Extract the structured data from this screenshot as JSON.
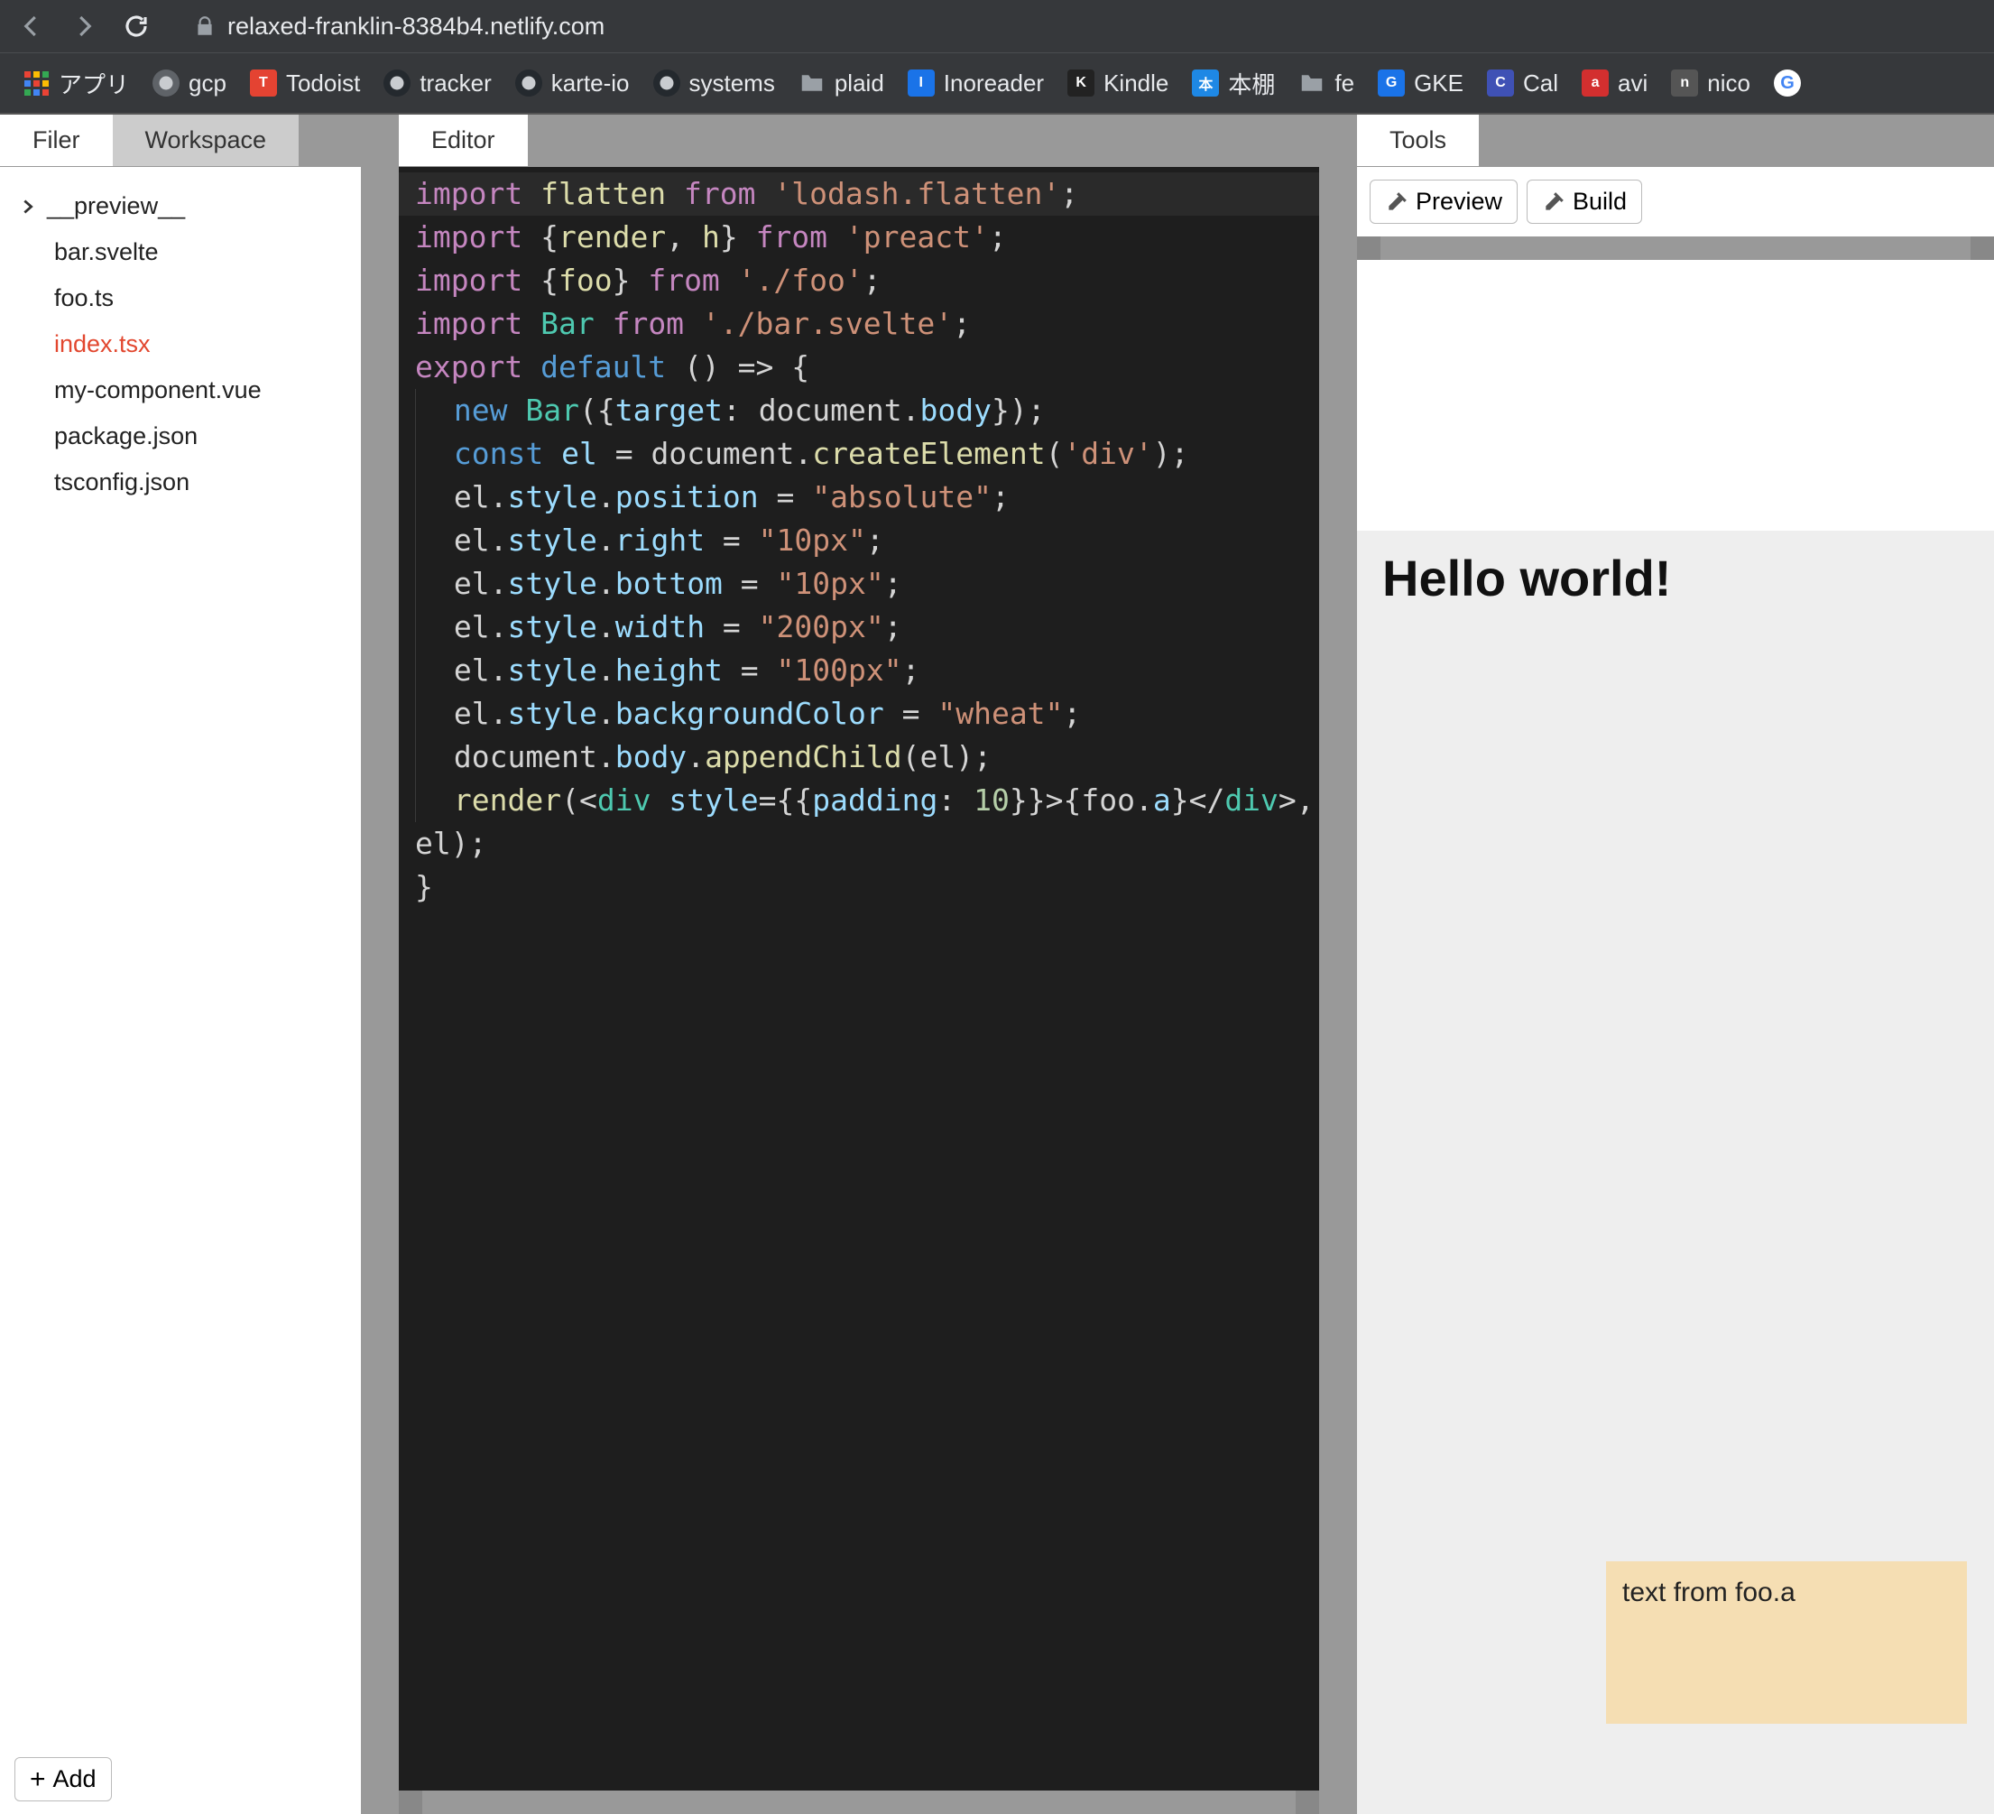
{
  "browser": {
    "url": "relaxed-franklin-8384b4.netlify.com",
    "bookmarks": [
      {
        "label": "アプリ",
        "kind": "apps"
      },
      {
        "label": "gcp",
        "kind": "g"
      },
      {
        "label": "Todoist",
        "kind": "todoist"
      },
      {
        "label": "tracker",
        "kind": "gh"
      },
      {
        "label": "karte-io",
        "kind": "gh"
      },
      {
        "label": "systems",
        "kind": "gh"
      },
      {
        "label": "plaid",
        "kind": "folder"
      },
      {
        "label": "Inoreader",
        "kind": "inoreader"
      },
      {
        "label": "Kindle",
        "kind": "kindle"
      },
      {
        "label": "本棚",
        "kind": "book"
      },
      {
        "label": "fe",
        "kind": "folder"
      },
      {
        "label": "GKE",
        "kind": "gke"
      },
      {
        "label": "Cal",
        "kind": "cal"
      },
      {
        "label": "avi",
        "kind": "avi"
      },
      {
        "label": "nico",
        "kind": "nico"
      }
    ]
  },
  "sidebar": {
    "tabs": {
      "filer": "Filer",
      "workspace": "Workspace"
    },
    "files": [
      {
        "name": "__preview__",
        "folder": true
      },
      {
        "name": "bar.svelte"
      },
      {
        "name": "foo.ts"
      },
      {
        "name": "index.tsx",
        "active": true
      },
      {
        "name": "my-component.vue"
      },
      {
        "name": "package.json"
      },
      {
        "name": "tsconfig.json"
      }
    ],
    "add_label": "Add"
  },
  "editor": {
    "tab": "Editor",
    "lines": [
      [
        [
          "key",
          "import"
        ],
        [
          "sp",
          " "
        ],
        [
          "fn",
          "flatten"
        ],
        [
          "sp",
          " "
        ],
        [
          "from",
          "from"
        ],
        [
          "sp",
          " "
        ],
        [
          "str",
          "'lodash.flatten'"
        ],
        [
          "punc",
          ";"
        ]
      ],
      [
        [
          "key",
          "import"
        ],
        [
          "sp",
          " "
        ],
        [
          "punc",
          "{"
        ],
        [
          "fn",
          "render"
        ],
        [
          "punc",
          ", "
        ],
        [
          "fn",
          "h"
        ],
        [
          "punc",
          "}"
        ],
        [
          "sp",
          " "
        ],
        [
          "from",
          "from"
        ],
        [
          "sp",
          " "
        ],
        [
          "str",
          "'preact'"
        ],
        [
          "punc",
          ";"
        ]
      ],
      [
        [
          "key",
          "import"
        ],
        [
          "sp",
          " "
        ],
        [
          "punc",
          "{"
        ],
        [
          "fn",
          "foo"
        ],
        [
          "punc",
          "}"
        ],
        [
          "sp",
          " "
        ],
        [
          "from",
          "from"
        ],
        [
          "sp",
          " "
        ],
        [
          "str",
          "'./foo'"
        ],
        [
          "punc",
          ";"
        ]
      ],
      [
        [
          "key",
          "import"
        ],
        [
          "sp",
          " "
        ],
        [
          "cls",
          "Bar"
        ],
        [
          "sp",
          " "
        ],
        [
          "from",
          "from"
        ],
        [
          "sp",
          " "
        ],
        [
          "str",
          "'./bar.svelte'"
        ],
        [
          "punc",
          ";"
        ]
      ],
      [
        [
          "key",
          "export"
        ],
        [
          "sp",
          " "
        ],
        [
          "def",
          "default"
        ],
        [
          "sp",
          " "
        ],
        [
          "punc",
          "() => {"
        ]
      ],
      [
        [
          "indent"
        ],
        [
          "const",
          "new"
        ],
        [
          "sp",
          " "
        ],
        [
          "cls",
          "Bar"
        ],
        [
          "punc",
          "({"
        ],
        [
          "prop",
          "target"
        ],
        [
          "punc",
          ": "
        ],
        [
          "id",
          "document"
        ],
        [
          "punc",
          "."
        ],
        [
          "prop",
          "body"
        ],
        [
          "punc",
          "});"
        ]
      ],
      [
        [
          "indent"
        ],
        [
          "const",
          "const"
        ],
        [
          "sp",
          " "
        ],
        [
          "prop",
          "el"
        ],
        [
          "sp",
          " = "
        ],
        [
          "id",
          "document"
        ],
        [
          "punc",
          "."
        ],
        [
          "fn",
          "createElement"
        ],
        [
          "punc",
          "("
        ],
        [
          "str",
          "'div'"
        ],
        [
          "punc",
          ");"
        ]
      ],
      [
        [
          "indent"
        ],
        [
          "id",
          "el"
        ],
        [
          "punc",
          "."
        ],
        [
          "prop",
          "style"
        ],
        [
          "punc",
          "."
        ],
        [
          "prop",
          "position"
        ],
        [
          "sp",
          " = "
        ],
        [
          "str",
          "\"absolute\""
        ],
        [
          "punc",
          ";"
        ]
      ],
      [
        [
          "indent"
        ],
        [
          "id",
          "el"
        ],
        [
          "punc",
          "."
        ],
        [
          "prop",
          "style"
        ],
        [
          "punc",
          "."
        ],
        [
          "prop",
          "right"
        ],
        [
          "sp",
          " = "
        ],
        [
          "str",
          "\"10px\""
        ],
        [
          "punc",
          ";"
        ]
      ],
      [
        [
          "indent"
        ],
        [
          "id",
          "el"
        ],
        [
          "punc",
          "."
        ],
        [
          "prop",
          "style"
        ],
        [
          "punc",
          "."
        ],
        [
          "prop",
          "bottom"
        ],
        [
          "sp",
          " = "
        ],
        [
          "str",
          "\"10px\""
        ],
        [
          "punc",
          ";"
        ]
      ],
      [
        [
          "indent"
        ],
        [
          "id",
          "el"
        ],
        [
          "punc",
          "."
        ],
        [
          "prop",
          "style"
        ],
        [
          "punc",
          "."
        ],
        [
          "prop",
          "width"
        ],
        [
          "sp",
          " = "
        ],
        [
          "str",
          "\"200px\""
        ],
        [
          "punc",
          ";"
        ]
      ],
      [
        [
          "indent"
        ],
        [
          "id",
          "el"
        ],
        [
          "punc",
          "."
        ],
        [
          "prop",
          "style"
        ],
        [
          "punc",
          "."
        ],
        [
          "prop",
          "height"
        ],
        [
          "sp",
          " = "
        ],
        [
          "str",
          "\"100px\""
        ],
        [
          "punc",
          ";"
        ]
      ],
      [
        [
          "indent"
        ],
        [
          "id",
          "el"
        ],
        [
          "punc",
          "."
        ],
        [
          "prop",
          "style"
        ],
        [
          "punc",
          "."
        ],
        [
          "prop",
          "backgroundColor"
        ],
        [
          "sp",
          " = "
        ],
        [
          "str",
          "\"wheat\""
        ],
        [
          "punc",
          ";"
        ]
      ],
      [
        [
          "indent"
        ],
        [
          "id",
          "document"
        ],
        [
          "punc",
          "."
        ],
        [
          "prop",
          "body"
        ],
        [
          "punc",
          "."
        ],
        [
          "fn",
          "appendChild"
        ],
        [
          "punc",
          "("
        ],
        [
          "id",
          "el"
        ],
        [
          "punc",
          ");"
        ]
      ],
      [
        [
          "indent"
        ],
        [
          "fn",
          "render"
        ],
        [
          "punc",
          "(<"
        ],
        [
          "cls",
          "div"
        ],
        [
          "sp",
          " "
        ],
        [
          "prop",
          "style"
        ],
        [
          "punc",
          "={{"
        ],
        [
          "prop",
          "padding"
        ],
        [
          "punc",
          ": "
        ],
        [
          "num",
          "10"
        ],
        [
          "punc",
          "}}>{"
        ],
        [
          "id",
          "foo"
        ],
        [
          "punc",
          "."
        ],
        [
          "prop",
          "a"
        ],
        [
          "punc",
          "}</"
        ],
        [
          "cls",
          "div"
        ],
        [
          "punc",
          ">,"
        ]
      ],
      [
        [
          "id",
          "el"
        ],
        [
          "punc",
          ");"
        ]
      ],
      [
        [
          "punc",
          "}"
        ]
      ]
    ]
  },
  "tools": {
    "tab": "Tools",
    "preview_label": "Preview",
    "build_label": "Build",
    "hello": "Hello world!",
    "box_text": "text from foo.a"
  }
}
